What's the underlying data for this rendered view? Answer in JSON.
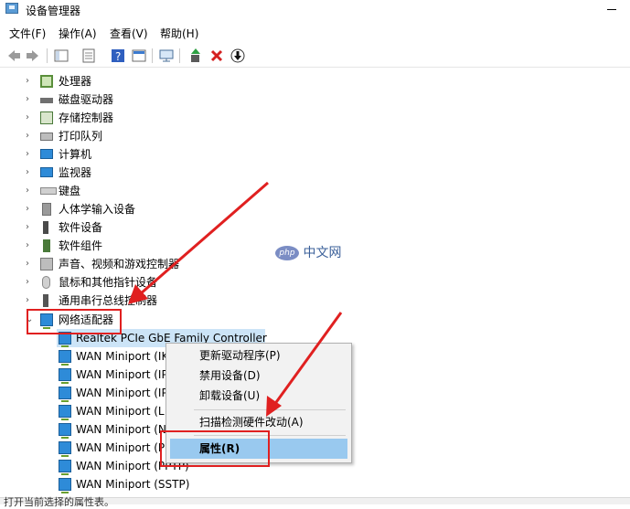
{
  "window": {
    "title": "设备管理器"
  },
  "menubar": [
    {
      "label": "文件(F)"
    },
    {
      "label": "操作(A)"
    },
    {
      "label": "查看(V)"
    },
    {
      "label": "帮助(H)"
    }
  ],
  "tree": {
    "categories": [
      {
        "label": "处理器",
        "icon": "processor-icon",
        "color": "#5a8f3b"
      },
      {
        "label": "磁盘驱动器",
        "icon": "disk-drive-icon",
        "color": "#707070"
      },
      {
        "label": "存储控制器",
        "icon": "storage-controller-icon",
        "color": "#4a7a3a"
      },
      {
        "label": "打印队列",
        "icon": "printer-icon",
        "color": "#6f6f6f"
      },
      {
        "label": "计算机",
        "icon": "computer-icon",
        "color": "#2e8bd8"
      },
      {
        "label": "监视器",
        "icon": "monitor-icon",
        "color": "#2e8bd8"
      },
      {
        "label": "键盘",
        "icon": "keyboard-icon",
        "color": "#8a8a8a"
      },
      {
        "label": "人体学输入设备",
        "icon": "hid-icon",
        "color": "#6f6f6f"
      },
      {
        "label": "软件设备",
        "icon": "software-device-icon",
        "color": "#4a4a4a"
      },
      {
        "label": "软件组件",
        "icon": "software-component-icon",
        "color": "#4a7a3a"
      },
      {
        "label": "声音、视频和游戏控制器",
        "icon": "speaker-icon",
        "color": "#777777"
      },
      {
        "label": "鼠标和其他指针设备",
        "icon": "mouse-icon",
        "color": "#8a8a8a"
      },
      {
        "label": "通用串行总线控制器",
        "icon": "usb-icon",
        "color": "#555555"
      }
    ],
    "expanded_category": {
      "label": "网络适配器",
      "icon": "network-adapter-icon"
    },
    "adapters": [
      {
        "label": "Realtek PCIe GbE Family Controller"
      },
      {
        "label": "WAN Miniport (IK"
      },
      {
        "label": "WAN Miniport (IP"
      },
      {
        "label": "WAN Miniport (IP"
      },
      {
        "label": "WAN Miniport (L"
      },
      {
        "label": "WAN Miniport (N"
      },
      {
        "label": "WAN Miniport (P"
      },
      {
        "label": "WAN Miniport (PPTP)"
      },
      {
        "label": "WAN Miniport (SSTP)"
      }
    ]
  },
  "context_menu": {
    "items": [
      {
        "label": "更新驱动程序(P)"
      },
      {
        "label": "禁用设备(D)"
      },
      {
        "label": "卸载设备(U)"
      },
      {
        "label": "扫描检测硬件改动(A)"
      },
      {
        "label": "属性(R)"
      }
    ]
  },
  "watermark": {
    "logo": "php",
    "text": "中文网"
  },
  "statusbar": {
    "text": "打开当前选择的属性表。"
  },
  "colors": {
    "annotation": "#e02020",
    "selection": "#99c9ef",
    "menu_bg": "#f2f2f2"
  }
}
